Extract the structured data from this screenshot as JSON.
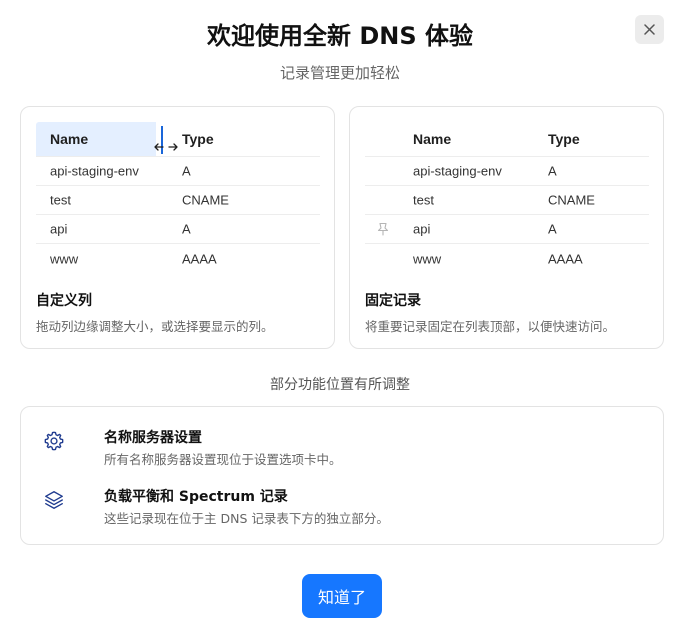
{
  "dialog": {
    "title": "欢迎使用全新 DNS 体验",
    "subtitle": "记录管理更加轻松",
    "close_icon": "close-icon"
  },
  "features": [
    {
      "table": {
        "headers": [
          "Name",
          "Type"
        ],
        "rows": [
          [
            "api-staging-env",
            "A"
          ],
          [
            "test",
            "CNAME"
          ],
          [
            "api",
            "A"
          ],
          [
            "www",
            "AAAA"
          ]
        ]
      },
      "heading": "自定义列",
      "description": "拖动列边缘调整大小，或选择要显示的列。",
      "icon": "column-resize-icon"
    },
    {
      "table": {
        "headers": [
          "Name",
          "Type"
        ],
        "rows": [
          [
            "api-staging-env",
            "A"
          ],
          [
            "test",
            "CNAME"
          ],
          [
            "api",
            "A"
          ],
          [
            "www",
            "AAAA"
          ]
        ]
      },
      "heading": "固定记录",
      "description": "将重要记录固定在列表顶部，以便快速访问。",
      "icon": "pin-icon"
    }
  ],
  "section_label": "部分功能位置有所调整",
  "changes": [
    {
      "icon": "gear-icon",
      "heading": "名称服务器设置",
      "description": "所有名称服务器设置现位于设置选项卡中。"
    },
    {
      "icon": "layers-icon",
      "heading": "负载平衡和 Spectrum 记录",
      "description": "这些记录现在位于主 DNS 记录表下方的独立部分。"
    }
  ],
  "confirm_button": "知道了",
  "colors": {
    "accent": "#1677ff",
    "highlight": "#e4efff",
    "icon": "#1f3b8f"
  }
}
